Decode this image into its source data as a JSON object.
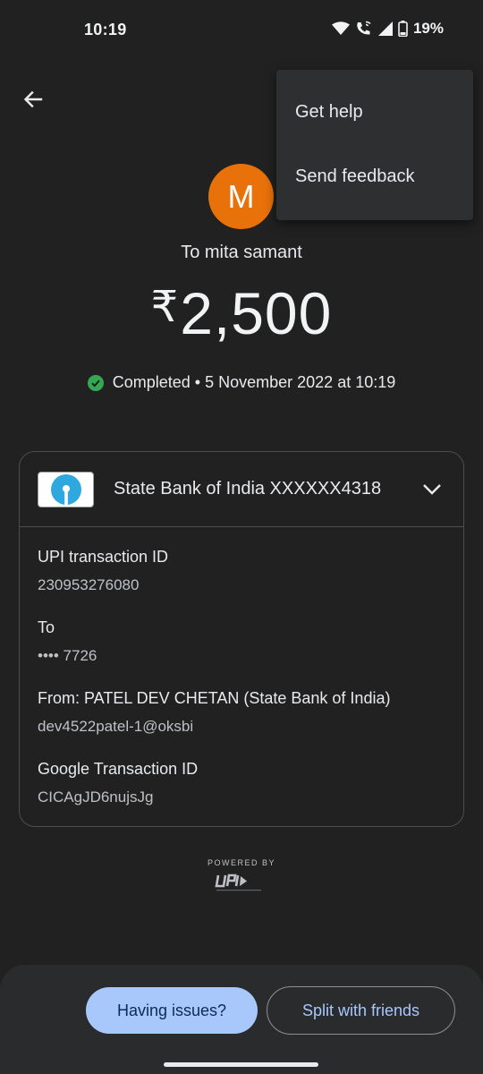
{
  "status_bar": {
    "time": "10:19",
    "battery": "19%"
  },
  "header": {
    "avatar_letter": "M",
    "recipient": "To mita samant"
  },
  "amount": {
    "currency_symbol": "₹",
    "value": "2,500"
  },
  "status": {
    "text": "Completed • 5 November 2022 at 10:19",
    "color": "#34a853"
  },
  "card": {
    "bank_label": "State Bank of India XXXXXX4318",
    "fields": [
      {
        "label": "UPI transaction ID",
        "value": "230953276080"
      },
      {
        "label": "To",
        "value": "•••• 7726"
      },
      {
        "label": "From: PATEL DEV  CHETAN (State Bank of India)",
        "value": "dev4522patel-1@oksbi"
      },
      {
        "label": "Google Transaction ID",
        "value": "CICAgJD6nujsJg"
      }
    ]
  },
  "footer": {
    "powered_by": "POWERED BY"
  },
  "actions": {
    "issues_label": "Having issues?",
    "split_label": "Split with friends"
  },
  "menu": {
    "items": [
      "Get help",
      "Send feedback"
    ]
  },
  "colors": {
    "accent": "#a8c7fa",
    "avatar": "#e8710a",
    "background": "#212121"
  }
}
